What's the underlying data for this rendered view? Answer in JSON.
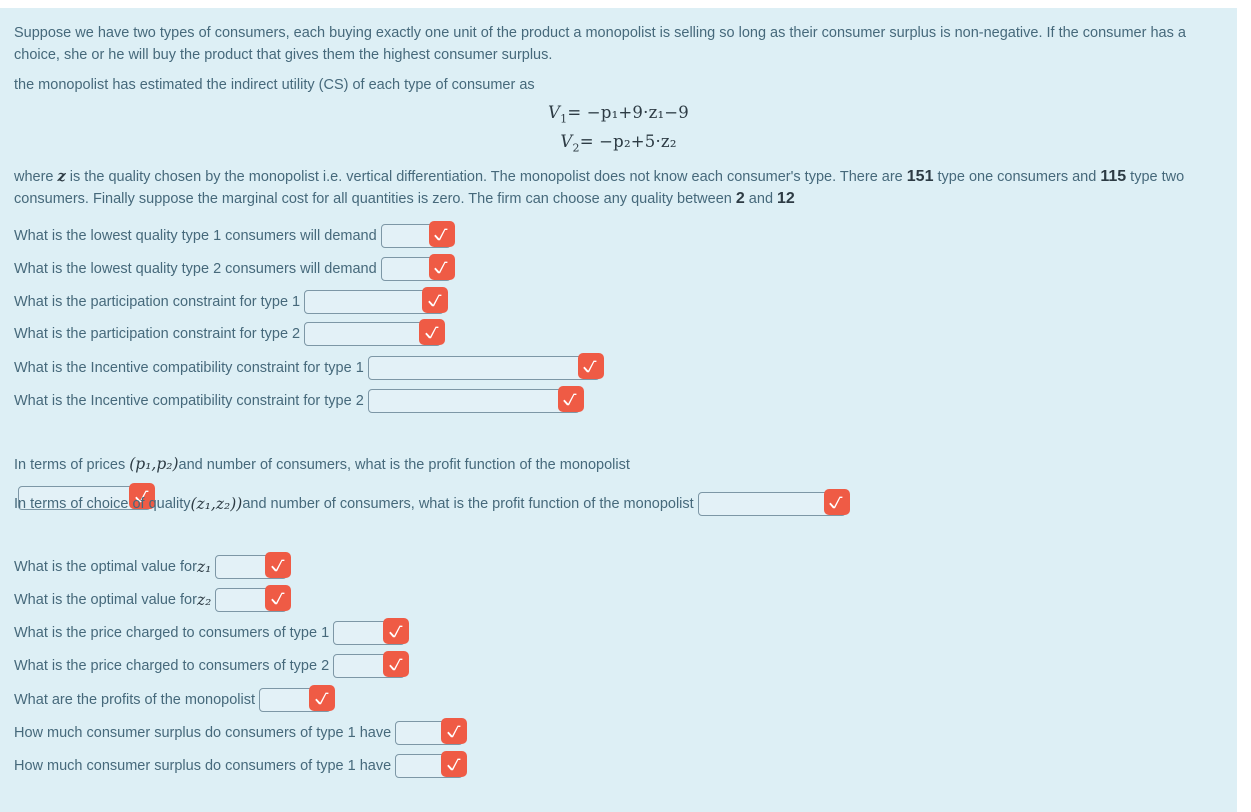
{
  "theme": {
    "page_bg": "#ddeff5",
    "text_color": "#46697b",
    "badge_color": "#ef5b45",
    "field_bg": "#e3f1f7",
    "field_border": "#7d97a6"
  },
  "intro": {
    "paragraph1": "Suppose we have two types of consumers, each buying exactly one unit of the product a monopolist is selling so long as their consumer surplus is non-negative. If the consumer has a choice, she or he will buy the product that gives them the highest consumer surplus.",
    "paragraph2": "the monopolist has estimated the indirect utility (CS) of each type of consumer as"
  },
  "formulas": [
    {
      "lhs": "V",
      "lhs_sub": "1",
      "rhs": "= −p₁+9·z₁−9"
    },
    {
      "lhs": "V",
      "lhs_sub": "2",
      "rhs": "= −p₂+5·z₂"
    }
  ],
  "setup": {
    "prefix": "where ",
    "z_symbol": "z",
    "middle": " is the quality chosen by the monopolist i.e. vertical differentiation. The monopolist does not know each consumer's type.   There are ",
    "type_one_count": "151",
    "after_count1": " type one consumers and ",
    "type_two_count": "115",
    "after_count2": " type two consumers. Finally suppose the marginal cost for all quantities is zero. The firm can choose any quality between ",
    "quality_min": "2",
    "between_and": " and ",
    "quality_max": "12"
  },
  "questions": [
    {
      "label": "What is the lowest quality type 1 consumers will demand",
      "value": "",
      "field_width": 70
    },
    {
      "label": "What is the lowest quality type 2 consumers will demand",
      "value": "",
      "field_width": 70
    },
    {
      "label": "What is the participation constraint for type 1",
      "value": "",
      "field_width": 140
    },
    {
      "label": "What is the participation constraint for type 2",
      "value": "",
      "field_width": 137
    },
    {
      "label": "What is the Incentive compatibility constraint for type 1",
      "value": "",
      "field_width": 232
    },
    {
      "label": "What is the Incentive compatibility constraint for type 2",
      "value": "",
      "field_width": 212
    }
  ],
  "profit_price_question": {
    "text_before": "In terms of prices ",
    "math": "(p₁,p₂)",
    "text_after": "and number of consumers, what is the profit function of the monopolist",
    "value": "",
    "field_width": 133
  },
  "profit_quality_question": {
    "text_before": "In terms of choice of quality  ",
    "math": "(z₁,z₂))",
    "text_after": " and number of consumers, what is the profit function of the monopolist",
    "value": "",
    "field_width": 148
  },
  "final_questions": [
    {
      "label": "What is the optimal value for ",
      "math": "z₁",
      "value": "",
      "field_width": 72
    },
    {
      "label": "What is the optimal value for ",
      "math": "z₂",
      "value": "",
      "field_width": 72
    },
    {
      "label": "What is the price charged to consumers of type 1",
      "math": "",
      "value": "",
      "field_width": 72
    },
    {
      "label": "What is the price charged to consumers of type 2",
      "math": "",
      "value": "",
      "field_width": 72
    },
    {
      "label": "What are the profits of the monopolist",
      "math": "",
      "value": "",
      "field_width": 72
    },
    {
      "label": "How much consumer surplus do consumers of type 1 have",
      "math": "",
      "value": "",
      "field_width": 68
    },
    {
      "label": "How much consumer surplus do consumers of type 1 have",
      "math": "",
      "value": "",
      "field_width": 68
    }
  ],
  "icons": {
    "check_badge": "check-mark-icon"
  }
}
